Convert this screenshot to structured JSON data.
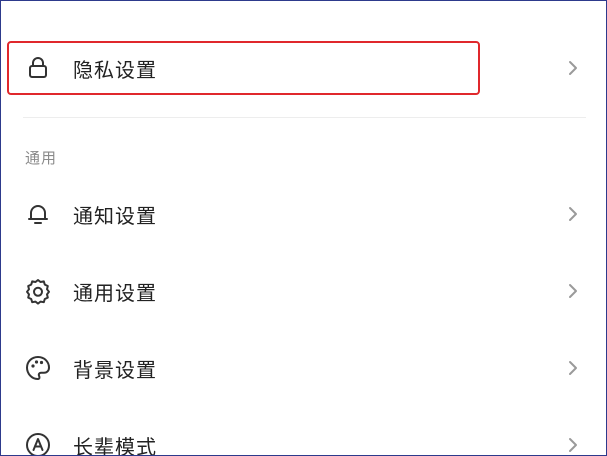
{
  "privacy_row": {
    "label": "隐私设置",
    "icon": "lock-icon"
  },
  "general_section": {
    "title": "通用",
    "items": [
      {
        "label": "通知设置",
        "icon": "bell-icon"
      },
      {
        "label": "通用设置",
        "icon": "gear-icon"
      },
      {
        "label": "背景设置",
        "icon": "palette-icon"
      },
      {
        "label": "长辈模式",
        "icon": "elder-mode-icon"
      }
    ]
  },
  "colors": {
    "highlight_border": "#e0282c",
    "frame_border": "#2d3a8c",
    "label_text": "#222222",
    "section_text": "#8a8a8a",
    "chevron": "#9a9a9a"
  }
}
